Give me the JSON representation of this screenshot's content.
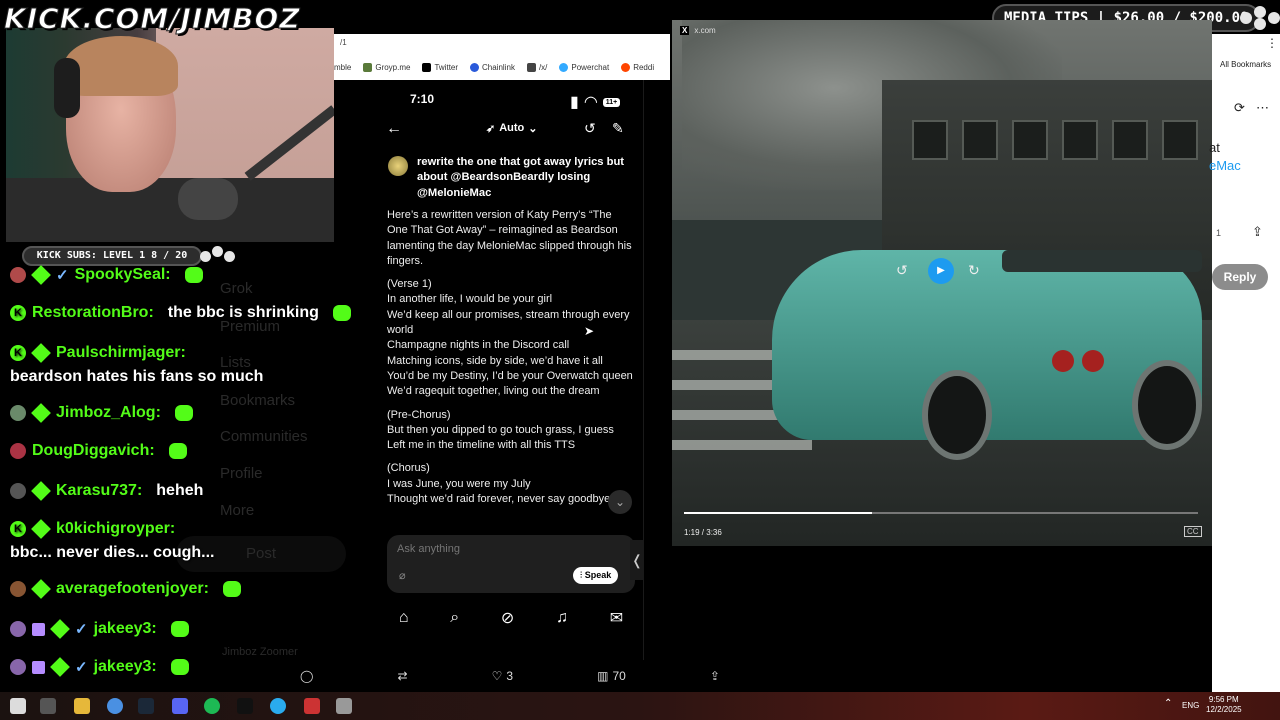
{
  "overlay": {
    "kick_url": "KICK.COM/JIMBOZ",
    "media_tips": "MEDIA TIPS | $26.00 / $200.00",
    "kick_subs": "KICK SUBS: LEVEL 1 8 / 20"
  },
  "browser": {
    "tab_fragment": "/1",
    "bookmarks": [
      {
        "label": "mble",
        "color": "#888888"
      },
      {
        "label": "Groyp.me",
        "color": "#5a7a3a"
      },
      {
        "label": "Twitter",
        "color": "#000000"
      },
      {
        "label": "Chainlink",
        "color": "#2a5ada"
      },
      {
        "label": "/x/",
        "color": "#444444"
      },
      {
        "label": "Powerchat",
        "color": "#33aaff"
      },
      {
        "label": "Reddi",
        "color": "#ff4500"
      }
    ],
    "all_bookmarks": "All Bookmarks"
  },
  "chat": [
    {
      "user": "SpookySeal:",
      "text": "",
      "badges": [
        "avatar",
        "gem",
        "verified"
      ],
      "emote": true,
      "avatar_color": "#b04a4a"
    },
    {
      "user": "RestorationBro:",
      "text": "the bbc is shrinking",
      "badges": [
        "k"
      ],
      "emote": true,
      "avatar_color": "#53fc18"
    },
    {
      "user": "Paulschirmjager:",
      "text": "",
      "badges": [
        "k",
        "gem"
      ],
      "emote": false,
      "avatar_color": "#53fc18"
    },
    {
      "user": "",
      "text": "beardson hates his fans so much",
      "badges": [],
      "emote": false,
      "avatar_color": ""
    },
    {
      "user": "Jimboz_Alog:",
      "text": "",
      "badges": [
        "avatar",
        "gem"
      ],
      "emote": true,
      "avatar_color": "#6a8a6a"
    },
    {
      "user": "DougDiggavich:",
      "text": "",
      "badges": [
        "avatar"
      ],
      "emote": true,
      "avatar_color": "#aa3344"
    },
    {
      "user": "Karasu737:",
      "text": "heheh",
      "badges": [
        "avatar",
        "gem"
      ],
      "emote": false,
      "avatar_color": "#555555"
    },
    {
      "user": "k0kichigroyper:",
      "text": "",
      "badges": [
        "k",
        "gem"
      ],
      "emote": false,
      "avatar_color": "#53fc18"
    },
    {
      "user": "",
      "text": "bbc... never dies... cough...",
      "badges": [],
      "emote": false,
      "avatar_color": ""
    },
    {
      "user": "averagefootenjoyer:",
      "text": "",
      "badges": [
        "avatar",
        "gem"
      ],
      "emote": true,
      "avatar_color": "#885533"
    },
    {
      "user": "jakeey3:",
      "text": "",
      "badges": [
        "avatar",
        "gift",
        "gem",
        "verified"
      ],
      "emote": true,
      "avatar_color": "#8866aa"
    },
    {
      "user": "jakeey3:",
      "text": "",
      "badges": [
        "avatar",
        "gift",
        "gem",
        "verified"
      ],
      "emote": true,
      "avatar_color": "#8866aa"
    }
  ],
  "bg_sidebar": [
    "Grok",
    "Premium",
    "Lists",
    "Bookmarks",
    "Communities",
    "Profile",
    "More",
    "Post"
  ],
  "bg_user": "Jimboz Zoomer",
  "phone": {
    "time": "7:10",
    "battery": "11+",
    "mode": "Auto",
    "prompt": "rewrite the one that got away lyrics but about @BeardsonBeardly losing @MelonieMac",
    "response": [
      "Here’s a rewritten version of Katy Perry’s “The One That Got Away” – reimagined as Beardson lamenting the day MelonieMac slipped through his fingers.",
      "(Verse 1)\nIn another life, I would be your girl\nWe’d keep all our promises, stream through every world\nChampagne nights in the Discord call\nMatching icons, side by side, we’d have it all\nYou’d be my Destiny, I’d be your Overwatch queen\nWe’d ragequit together, living out the dream",
      "(Pre-Chorus)\nBut then you dipped to go touch grass, I guess\nLeft me in the timeline with all this TTS",
      "(Chorus)\nI was June, you were my July\nThought we’d raid forever, never say goodbye"
    ],
    "ask_placeholder": "Ask anything",
    "speak_label": "Speak"
  },
  "tweet": {
    "likes": "3",
    "views": "70"
  },
  "video": {
    "source": "x.com",
    "time": "1:19 / 3:36",
    "progress": 0.366,
    "cc": "CC"
  },
  "right_panel": {
    "at_fragment": "at",
    "mac_fragment": "eMac",
    "count": "1",
    "reply_label": "Reply"
  },
  "taskbar": {
    "lang": "ENG",
    "time": "9:56 PM",
    "date": "12/2/2025"
  }
}
